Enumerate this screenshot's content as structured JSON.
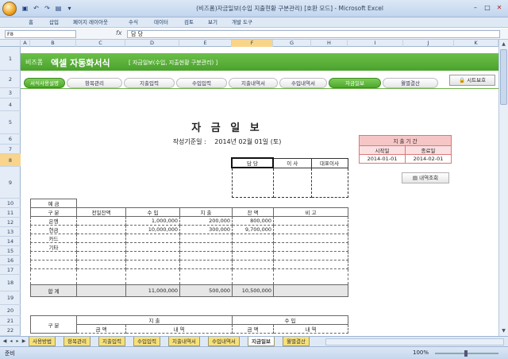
{
  "window": {
    "title": "(비즈폼)자금일보(수입 지출현황 구분관리) [호환 모드] - Microsoft Excel"
  },
  "ribbon": {
    "tabs": [
      "홈",
      "삽입",
      "페이지 레이아웃",
      "수식",
      "데이터",
      "검토",
      "보기",
      "개발 도구"
    ]
  },
  "formula_bar": {
    "name_box": "F8",
    "formula": "담 당"
  },
  "columns": [
    "A",
    "B",
    "C",
    "D",
    "E",
    "F",
    "G",
    "H",
    "I",
    "J",
    "K",
    "L"
  ],
  "selected_column": "F",
  "rows": [
    "1",
    "2",
    "3",
    "4",
    "5",
    "6",
    "7",
    "8",
    "9",
    "10",
    "11",
    "12",
    "13",
    "14",
    "15",
    "16",
    "17",
    "18",
    "19",
    "20",
    "21",
    "22"
  ],
  "selected_row": "8",
  "banner": {
    "brand": "비즈폼",
    "title": "엑셀 자동화서식",
    "subtitle": "[ 자금일보(수입, 지출현황 구분관리) ]"
  },
  "nav_tabs": [
    "서식사용설명",
    "항목관리",
    "지출입력",
    "수입입력",
    "지출내역서",
    "수입내역서",
    "자금일보",
    "월별결산"
  ],
  "active_nav": "자금일보",
  "protect_button": "시트보호",
  "document": {
    "title": "자 금 일 보",
    "date_label": "작성기준일 :",
    "date_value": "2014년 02월 01일 (토)"
  },
  "approval": {
    "headers": [
      "담 당",
      "이 사",
      "대표이사"
    ]
  },
  "period": {
    "title": "지 출 기 간",
    "start_label": "시작일",
    "end_label": "종료일",
    "start": "2014-01-01",
    "end": "2014-02-01"
  },
  "inquiry_button": "내역조회",
  "summary": {
    "section_label": "예 금",
    "headers": [
      "구 분",
      "전일잔액",
      "수 입",
      "지 출",
      "잔 액",
      "비 고"
    ],
    "rows": [
      {
        "name": "은행",
        "prev": "",
        "income": "1,000,000",
        "expense": "200,000",
        "balance": "800,000",
        "note": ""
      },
      {
        "name": "현금",
        "prev": "",
        "income": "10,000,000",
        "expense": "300,000",
        "balance": "9,700,000",
        "note": ""
      },
      {
        "name": "카드",
        "prev": "",
        "income": "",
        "expense": "",
        "balance": "",
        "note": ""
      },
      {
        "name": "기타",
        "prev": "",
        "income": "",
        "expense": "",
        "balance": "",
        "note": ""
      },
      {
        "name": "",
        "prev": "",
        "income": "",
        "expense": "",
        "balance": "",
        "note": ""
      },
      {
        "name": "",
        "prev": "",
        "income": "",
        "expense": "",
        "balance": "",
        "note": ""
      },
      {
        "name": "",
        "prev": "",
        "income": "",
        "expense": "",
        "balance": "",
        "note": ""
      }
    ],
    "total": {
      "name": "합 계",
      "prev": "",
      "income": "11,000,000",
      "expense": "500,000",
      "balance": "10,500,000",
      "note": ""
    }
  },
  "detail": {
    "category": "구 분",
    "expense": "지 출",
    "income": "수 입",
    "amount": "금 액",
    "content": "내 역"
  },
  "sheet_tabs": [
    "사용방법",
    "항목관리",
    "지출입력",
    "수입입력",
    "지출내역서",
    "수입내역서",
    "지금일보",
    "월별결산"
  ],
  "active_sheet": "지금일보",
  "status": {
    "mode": "준비",
    "zoom": "100%"
  }
}
